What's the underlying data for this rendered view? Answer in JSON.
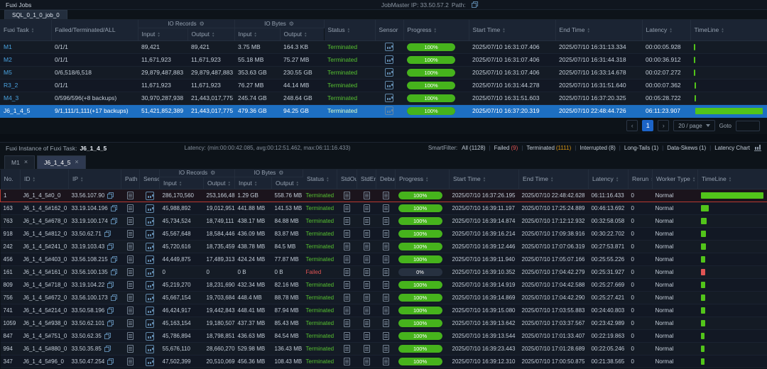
{
  "colors": {
    "green": "#52c41a",
    "red": "#e05454",
    "selected_blue": "#1d6fc2",
    "accent_blue": "#4aa3e0"
  },
  "icons": {
    "gear": "⚙"
  },
  "topbar": {
    "title": "Fuxi Jobs",
    "jobmaster": "JobMaster IP: 33.50.57.2",
    "path_label": "Path:"
  },
  "job_tab": {
    "label": "SQL_0_1_0_job_0"
  },
  "task_table": {
    "group_io_records": "IO Records",
    "group_io_bytes": "IO Bytes",
    "headers": {
      "task": "Fuxi Task",
      "fta": "Failed/Terminated/ALL",
      "input": "Input",
      "output": "Output",
      "status": "Status",
      "sensor": "Sensor",
      "progress": "Progress",
      "start": "Start Time",
      "end": "End Time",
      "latency": "Latency",
      "timeline": "TimeLine"
    },
    "rows": [
      {
        "task": "M1",
        "fta": "0/1/1",
        "rec_in": "89,421",
        "rec_out": "89,421",
        "b_in": "3.75 MB",
        "b_out": "164.3 KB",
        "status": "Terminated",
        "progress": "100%",
        "pct": 100,
        "start": "2025/07/10 16:31:07.406",
        "end": "2025/07/10 16:31:13.334",
        "latency": "00:00:05.928",
        "tl_left": 0.3,
        "tl_width": 1.2
      },
      {
        "task": "M2",
        "fta": "0/1/1",
        "rec_in": "11,671,923",
        "rec_out": "11,671,923",
        "b_in": "55.18 MB",
        "b_out": "75.27 MB",
        "status": "Terminated",
        "progress": "100%",
        "pct": 100,
        "start": "2025/07/10 16:31:07.406",
        "end": "2025/07/10 16:31:44.318",
        "latency": "00:00:36.912",
        "tl_left": 0.3,
        "tl_width": 1.2
      },
      {
        "task": "M5",
        "fta": "0/6,518/6,518",
        "rec_in": "29,879,487,883",
        "rec_out": "29,879,487,883",
        "b_in": "353.63 GB",
        "b_out": "230.55 GB",
        "status": "Terminated",
        "progress": "100%",
        "pct": 100,
        "start": "2025/07/10 16:31:07.406",
        "end": "2025/07/10 16:33:14.678",
        "latency": "00:02:07.272",
        "tl_left": 0.3,
        "tl_width": 1.6
      },
      {
        "task": "R3_2",
        "fta": "0/1/1",
        "rec_in": "11,671,923",
        "rec_out": "11,671,923",
        "b_in": "76.27 MB",
        "b_out": "44.14 MB",
        "status": "Terminated",
        "progress": "100%",
        "pct": 100,
        "start": "2025/07/10 16:31:44.278",
        "end": "2025/07/10 16:31:51.640",
        "latency": "00:00:07.362",
        "tl_left": 0.5,
        "tl_width": 1.2
      },
      {
        "task": "M4_3",
        "fta": "0/596/596(+8 backups)",
        "rec_in": "30,970,287,938",
        "rec_out": "21,443,017,775",
        "b_in": "245.74 GB",
        "b_out": "248.64 GB",
        "status": "Terminated",
        "progress": "100%",
        "pct": 100,
        "start": "2025/07/10 16:31:51.603",
        "end": "2025/07/10 16:37:20.325",
        "latency": "00:05:28.722",
        "tl_left": 0.6,
        "tl_width": 2.4
      },
      {
        "task": "J6_1_4_5",
        "fta": "9/1,111/1,111(+17 backups)",
        "rec_in": "51,421,852,389",
        "rec_out": "21,443,017,775",
        "b_in": "479.36 GB",
        "b_out": "94.25 GB",
        "status": "Terminated",
        "progress": "100%",
        "pct": 100,
        "start": "2025/07/10 16:37:20.319",
        "end": "2025/07/10 22:48:44.726",
        "latency": "06:11:23.907",
        "tl_left": 1.8,
        "tl_width": 97,
        "selected": true
      }
    ]
  },
  "pagination": {
    "prev": "‹",
    "page": "1",
    "next": "›",
    "size": "20 / page",
    "goto": "Goto"
  },
  "instance_header": {
    "title_label": "Fuxi Instance of Fuxi Task:",
    "task_name": "J6_1_4_5",
    "latency_summary": "Latency: (min:00:00:42.085, avg:00:12:51.462, max:06:11:16.433)",
    "smartfilter_label": "SmartFilter:",
    "filters": [
      {
        "label": "All",
        "count_text": "(1128)",
        "count_color": "#c3cdd8"
      },
      {
        "label": "Failed",
        "count_text": "(9)",
        "count_color": "#e05454"
      },
      {
        "label": "Terminated",
        "count_text": "(1111)",
        "count_color": "#d89614"
      },
      {
        "label": "Interrupted",
        "count_text": "(8)",
        "count_color": "#c3cdd8"
      },
      {
        "label": "Long-Tails",
        "count_text": "(1)",
        "count_color": "#c3cdd8"
      },
      {
        "label": "Data-Skews",
        "count_text": "(1)",
        "count_color": "#c3cdd8"
      },
      {
        "label": "Latency Chart",
        "count_text": "",
        "icon": "latency-chart-icon"
      }
    ]
  },
  "instance_tabs": [
    {
      "label": "M1",
      "active": false
    },
    {
      "label": "J6_1_4_5",
      "active": true
    }
  ],
  "instance_table": {
    "group_io_records": "IO Records",
    "group_io_bytes": "IO Bytes",
    "headers": {
      "no": "No.",
      "id": "ID",
      "ip": "IP",
      "path": "Path",
      "sensor": "Sensor",
      "input": "Input",
      "output": "Output",
      "status": "Status",
      "stdout": "StdOut",
      "stderr": "StdErr",
      "debug": "Debug",
      "progress": "Progress",
      "start": "Start Time",
      "end": "End Time",
      "latency": "Latency",
      "rerun": "Rerun",
      "worker": "Worker Type",
      "timeline": "TimeLine"
    },
    "rows": [
      {
        "no": "1",
        "id": "J6_1_4_5#0_0",
        "ip": "33.56.107.90",
        "rec_in": "286,170,560",
        "rec_out": "253,166,481",
        "b_in": "1.29 GB",
        "b_out": "558.76 MB",
        "status": "Terminated",
        "progress": "100%",
        "pct": 100,
        "start": "2025/07/10 16:37:26.195",
        "end": "2025/07/10 22:48:42.628",
        "latency": "06:11:16.433",
        "rerun": "0",
        "worker": "Normal",
        "tl_left": 0.3,
        "tl_width": 99,
        "highlight": true
      },
      {
        "no": "163",
        "id": "J6_1_4_5#162_0",
        "ip": "33.19.104.196",
        "rec_in": "45,988,892",
        "rec_out": "19,012,951",
        "b_in": "441.88 MB",
        "b_out": "141.53 MB",
        "status": "Terminated",
        "progress": "100%",
        "pct": 100,
        "start": "2025/07/10 16:39:11.197",
        "end": "2025/07/10 17:25:24.889",
        "latency": "00:46:13.692",
        "rerun": "0",
        "worker": "Normal",
        "tl_left": 0.5,
        "tl_width": 12.5
      },
      {
        "no": "763",
        "id": "J6_1_4_5#678_0",
        "ip": "33.19.100.174",
        "rec_in": "45,734,524",
        "rec_out": "18,749,111",
        "b_in": "438.17 MB",
        "b_out": "84.88 MB",
        "status": "Terminated",
        "progress": "100%",
        "pct": 100,
        "start": "2025/07/10 16:39:14.874",
        "end": "2025/07/10 17:12:12.932",
        "latency": "00:32:58.058",
        "rerun": "0",
        "worker": "Normal",
        "tl_left": 0.5,
        "tl_width": 8.9
      },
      {
        "no": "918",
        "id": "J6_1_4_5#812_0",
        "ip": "33.50.62.71",
        "rec_in": "45,567,648",
        "rec_out": "18,584,446",
        "b_in": "436.09 MB",
        "b_out": "83.87 MB",
        "status": "Terminated",
        "progress": "100%",
        "pct": 100,
        "start": "2025/07/10 16:39:16.214",
        "end": "2025/07/10 17:09:38.916",
        "latency": "00:30:22.702",
        "rerun": "0",
        "worker": "Normal",
        "tl_left": 0.5,
        "tl_width": 8.2
      },
      {
        "no": "242",
        "id": "J6_1_4_5#241_0",
        "ip": "33.19.103.43",
        "rec_in": "45,720,616",
        "rec_out": "18,735,459",
        "b_in": "438.78 MB",
        "b_out": "84.5 MB",
        "status": "Terminated",
        "progress": "100%",
        "pct": 100,
        "start": "2025/07/10 16:39:12.446",
        "end": "2025/07/10 17:07:06.319",
        "latency": "00:27:53.871",
        "rerun": "0",
        "worker": "Normal",
        "tl_left": 0.5,
        "tl_width": 7.5
      },
      {
        "no": "456",
        "id": "J6_1_4_5#403_0",
        "ip": "33.56.108.215",
        "rec_in": "44,449,875",
        "rec_out": "17,489,313",
        "b_in": "424.24 MB",
        "b_out": "77.87 MB",
        "status": "Terminated",
        "progress": "100%",
        "pct": 100,
        "start": "2025/07/10 16:39:11.940",
        "end": "2025/07/10 17:05:07.166",
        "latency": "00:25:55.226",
        "rerun": "0",
        "worker": "Normal",
        "tl_left": 0.5,
        "tl_width": 7.0
      },
      {
        "no": "161",
        "id": "J6_1_4_5#161_0",
        "ip": "33.56.100.135",
        "rec_in": "0",
        "rec_out": "0",
        "b_in": "0 B",
        "b_out": "0 B",
        "status": "Failed",
        "progress": "0%",
        "pct": 0,
        "start": "2025/07/10 16:39:10.352",
        "end": "2025/07/10 17:04:42.279",
        "latency": "00:25:31.927",
        "rerun": "0",
        "worker": "Normal",
        "tl_left": 0.5,
        "tl_width": 6.9
      },
      {
        "no": "809",
        "id": "J6_1_4_5#718_0",
        "ip": "33.19.104.22",
        "rec_in": "45,219,270",
        "rec_out": "18,231,690",
        "b_in": "432.34 MB",
        "b_out": "82.16 MB",
        "status": "Terminated",
        "progress": "100%",
        "pct": 100,
        "start": "2025/07/10 16:39:14.919",
        "end": "2025/07/10 17:04:42.588",
        "latency": "00:25:27.669",
        "rerun": "0",
        "worker": "Normal",
        "tl_left": 0.5,
        "tl_width": 6.9
      },
      {
        "no": "756",
        "id": "J6_1_4_5#672_0",
        "ip": "33.56.100.173",
        "rec_in": "45,667,154",
        "rec_out": "19,703,684",
        "b_in": "448.4 MB",
        "b_out": "88.78 MB",
        "status": "Terminated",
        "progress": "100%",
        "pct": 100,
        "start": "2025/07/10 16:39:14.869",
        "end": "2025/07/10 17:04:42.290",
        "latency": "00:25:27.421",
        "rerun": "0",
        "worker": "Normal",
        "tl_left": 0.5,
        "tl_width": 6.9
      },
      {
        "no": "741",
        "id": "J6_1_4_5#214_0",
        "ip": "33.50.58.196",
        "rec_in": "46,424,917",
        "rec_out": "19,442,843",
        "b_in": "448.41 MB",
        "b_out": "87.94 MB",
        "status": "Terminated",
        "progress": "100%",
        "pct": 100,
        "start": "2025/07/10 16:39:15.080",
        "end": "2025/07/10 17:03:55.883",
        "latency": "00:24:40.803",
        "rerun": "0",
        "worker": "Normal",
        "tl_left": 0.5,
        "tl_width": 6.7
      },
      {
        "no": "1059",
        "id": "J6_1_4_5#938_0",
        "ip": "33.50.62.101",
        "rec_in": "45,163,154",
        "rec_out": "19,180,507",
        "b_in": "437.37 MB",
        "b_out": "85.43 MB",
        "status": "Terminated",
        "progress": "100%",
        "pct": 100,
        "start": "2025/07/10 16:39:13.642",
        "end": "2025/07/10 17:03:37.567",
        "latency": "00:23:42.989",
        "rerun": "0",
        "worker": "Normal",
        "tl_left": 0.5,
        "tl_width": 6.4
      },
      {
        "no": "847",
        "id": "J6_1_4_5#751_0",
        "ip": "33.50.62.35",
        "rec_in": "45,786,894",
        "rec_out": "18,798,851",
        "b_in": "436.63 MB",
        "b_out": "84.54 MB",
        "status": "Terminated",
        "progress": "100%",
        "pct": 100,
        "start": "2025/07/10 16:39:13.544",
        "end": "2025/07/10 17:01:33.407",
        "latency": "00:22:19.863",
        "rerun": "0",
        "worker": "Normal",
        "tl_left": 0.5,
        "tl_width": 6.0
      },
      {
        "no": "994",
        "id": "J6_1_4_5#880_0",
        "ip": "33.50.35.85",
        "rec_in": "55,676,110",
        "rec_out": "28,660,270",
        "b_in": "529.98 MB",
        "b_out": "136.43 MB",
        "status": "Terminated",
        "progress": "100%",
        "pct": 100,
        "start": "2025/07/10 16:39:23.443",
        "end": "2025/07/10 17:01:28.689",
        "latency": "00:22:05.246",
        "rerun": "0",
        "worker": "Normal",
        "tl_left": 0.5,
        "tl_width": 6.0
      },
      {
        "no": "347",
        "id": "J6_1_4_5#96_0",
        "ip": "33.50.47.254",
        "rec_in": "47,502,399",
        "rec_out": "20,510,069",
        "b_in": "456.36 MB",
        "b_out": "108.43 MB",
        "status": "Terminated",
        "progress": "100%",
        "pct": 100,
        "start": "2025/07/10 16:39:12.310",
        "end": "2025/07/10 17:00:50.875",
        "latency": "00:21:38.565",
        "rerun": "0",
        "worker": "Normal",
        "tl_left": 0.5,
        "tl_width": 5.8
      }
    ]
  }
}
